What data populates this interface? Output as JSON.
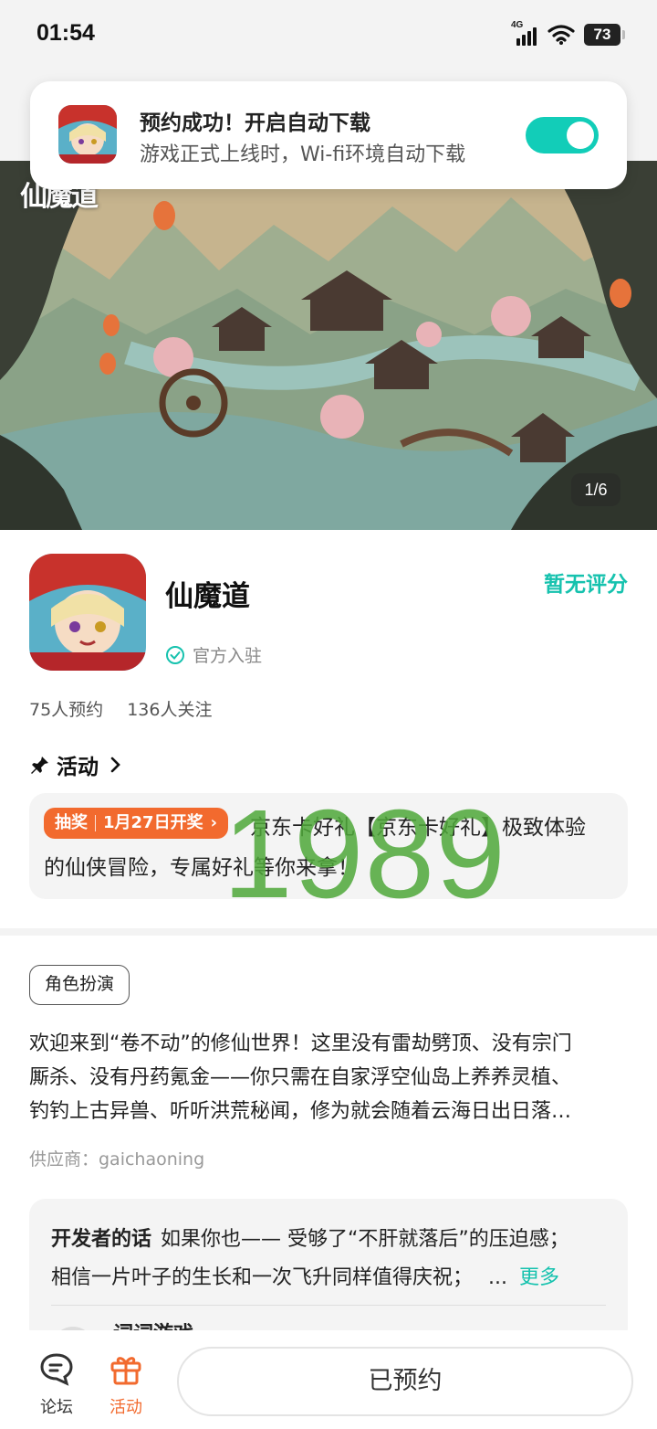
{
  "status_bar": {
    "time": "01:54",
    "network": "4G",
    "battery": "73"
  },
  "toast": {
    "title": "预约成功！开启自动下载",
    "subtitle": "游戏正式上线时，Wi-fi环境自动下载",
    "auto_download_enabled": true
  },
  "banner": {
    "logo_text": "仙魔道",
    "counter": "1/6",
    "current_index": 1,
    "total": 6
  },
  "app": {
    "name": "仙魔道",
    "rating": "暂无评分",
    "official_badge": "官方入驻",
    "reservations": "75人预约",
    "followers": "136人关注"
  },
  "activity": {
    "heading": "活动",
    "badge_type": "抽奖",
    "badge_date": "1月27日开奖",
    "line1": "京东卡好礼【京东卡好礼】极致体验",
    "line2": "的仙侠冒险，专属好礼等你来拿！"
  },
  "watermark": "1989",
  "details": {
    "tag": "角色扮演",
    "description_lines": [
      "欢迎来到“卷不动”的修仙世界！这里没有雷劫劈顶、没有宗门",
      "厮杀、没有丹药氪金——你只需在自家浮空仙岛上养养灵植、",
      "钓钓上古异兽、听听洪荒秘闻，修为就会随着云海日出日落…"
    ],
    "supplier": "供应商：gaichaoning"
  },
  "developer_note": {
    "label": "开发者的话",
    "line1": "如果你也—— 受够了“不肝就落后”的压迫感；",
    "line2": "相信一片叶子的生长和一次飞升同样值得庆祝；",
    "ellipsis": "...",
    "more": "更多",
    "author": "词词游戏"
  },
  "bottom_nav": {
    "forum": "论坛",
    "activity": "活动",
    "reserved_button": "已预约"
  },
  "colors": {
    "accent_teal": "#16c2ae",
    "toggle_on": "#12cdb8",
    "accent_orange": "#f26a2e",
    "watermark_green": "#4fa83a"
  }
}
